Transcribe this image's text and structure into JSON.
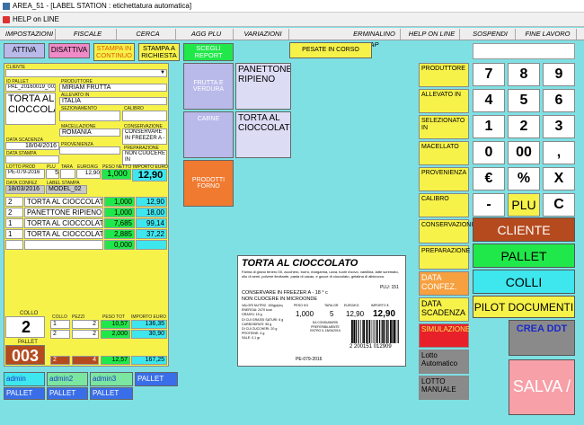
{
  "window": {
    "title": "AREA_51 - [LABEL STATION : etichettatura automatica]",
    "help": "HELP on LINE"
  },
  "menu": [
    "IMPOSTAZIONI",
    "FISCALE",
    "CERCA",
    "AGG PLU",
    "VARIAZIONI",
    "ERMINALINO AP",
    "HELP ON LINE",
    "SOSPENDI",
    "FINE LAVORO"
  ],
  "toolbar": {
    "attiva": "ATTIVA",
    "disattiva": "DISATTIVA",
    "stampa_continuo": "STAMPA IN CONTINUO",
    "stampa_richiesta": "STAMPA A RICHIESTA",
    "scegli_report": "SCEGLI REPORT",
    "pesate": "PESATE IN CORSO"
  },
  "form": {
    "cliente_lbl": "CLIENTE",
    "id_pallet_lbl": "ID PALLET",
    "id_pallet": "PAL_20160019_003",
    "produttore_lbl": "PRODUTTORE",
    "produttore": "MIRIAM FRUTTA",
    "allevato_lbl": "ALLEVATO IN",
    "allevato": "ITALIA",
    "product": "TORTA AL CIOCCOLATO",
    "sezionamento_lbl": "SEZIONAMENTO",
    "calibro_lbl": "CALIBRO",
    "macellazione_lbl": "MACELLAZIONE",
    "macellazione": "ROMANIA",
    "conservazione_lbl": "CONSERVAZIONE",
    "conservazione": "CONSERVARE IN FREEZER A -",
    "scadenza_lbl": "DATA SCADENZA",
    "scadenza": "18/04/2016",
    "provenienza_lbl": "PROVENIENZA",
    "preparazione_lbl": "PREPARAZIONE",
    "preparazione": "NON CUOCERE IN",
    "stampa_lbl": "DATA STAMPA",
    "lotto_lbl": "LOTTO PROD",
    "plu_lbl": "PLU",
    "tara_lbl": "TARA",
    "eurokg_lbl": "EURO/KG",
    "peso_lbl": "PESO NETTO",
    "importo_lbl": "IMPORTO EURO",
    "lotto": "PE-079-2016",
    "plu": "5",
    "tara": "",
    "eurokg": "12,90",
    "peso": "1,000",
    "importo": "12,90",
    "confez_lbl": "DATA CONFEZ",
    "label_lbl": "LABEL STAMPA",
    "confez": "18/03/2016",
    "label": "MODEL_02"
  },
  "weighings": [
    {
      "n": "2",
      "name": "TORTA AL CIOCCOLATO",
      "w": "1,000",
      "amt": "12,90"
    },
    {
      "n": "2",
      "name": "PANETTONE RIPIENO",
      "w": "1,000",
      "amt": "18,00"
    },
    {
      "n": "1",
      "name": "TORTA AL CIOCCOLATO",
      "w": "7,685",
      "amt": "99,14"
    },
    {
      "n": "1",
      "name": "TORTA AL CIOCCOLATO",
      "w": "2,885",
      "amt": "37,22"
    },
    {
      "n": "",
      "name": "",
      "w": "0,000",
      "amt": ""
    }
  ],
  "collo": {
    "label": "COLLO",
    "value": "2"
  },
  "pallet": {
    "label": "PALLET",
    "value": "003"
  },
  "totals": {
    "hdr": [
      "COLLO",
      "PEZZI",
      "PESO TOT",
      "IMPORTO EURO"
    ],
    "rows": [
      {
        "collo": "1",
        "pezzi": "2",
        "peso": "10,57",
        "imp": "136,35"
      },
      {
        "collo": "2",
        "pezzi": "2",
        "peso": "2,000",
        "imp": "30,90"
      }
    ],
    "sum": {
      "collo": "2",
      "pezzi": "4",
      "peso": "12,57",
      "imp": "167,25"
    }
  },
  "users": {
    "a1": "admin",
    "a2": "admin2",
    "a3": "admin3",
    "p": "PALLET"
  },
  "categories": [
    {
      "cat": "FRUTTA E VERDURA",
      "prod": "PANETTONE RIPIENO"
    },
    {
      "cat": "CARNE",
      "prod": "TORTA AL CIOCCOLATO"
    },
    {
      "cat": "PRODOTTI FORNO",
      "prod": ""
    }
  ],
  "label_preview": {
    "title": "TORTA AL CIOCCOLATO",
    "ingredients": "Farina di grano tenero 00, zucchero, burro, margarina, uova, tuorli d'uovo, vanillina, latte scremato, olio di semi, polvere lievitante, pasta di cacao, e gocce di cioccolato, gelatina di albicocca.",
    "plu": "PLU: 151",
    "cons1": "CONSERVARE IN FREEZER A - 18 ° c",
    "cons2": "NON CUOCERE IN MICROONDE",
    "nutri": "VALORI NUTRIZ. 100g(a)eq\nENERGIA: 2470 kcal\nGRASSI: 15 g\nDI CUI GRASSI SATURI: 6 g\nCARBOIDRATI: 55 g\nDI CUI ZUCCHERI: 20 g\nPROTEINE: 4 g\nSALE: 0,1 gr",
    "peso_lbl": "PESO KG",
    "tara_lbl": "TARA GR",
    "eurokg_lbl": "EURO/KG",
    "importo_lbl": "IMPORTO €",
    "peso": "1,000",
    "tara": "5",
    "eurokg": "12,90",
    "importo": "12,90",
    "lotto": "PE-079-2016",
    "date_note": "DA CONSUMARSI PREFERIBILMENTE ENTRO IL 18/04/2016",
    "barcode": "2 200151 012909"
  },
  "right_side": [
    "PRODUTTORE",
    "ALLEVATO IN",
    "SELEZIONATO IN",
    "MACELLATO",
    "PROVENIENZA",
    "CALIBRO",
    "CONSERVAZIONI",
    "PREPARAZIONE",
    "DATA CONFEZ.",
    "DATA SCADENZA",
    "SIMULAZIONE",
    "Lotto Automatico",
    "LOTTO MANUALE"
  ],
  "keypad": [
    "7",
    "8",
    "9",
    "4",
    "5",
    "6",
    "1",
    "2",
    "3",
    "0",
    "00",
    ",",
    "€",
    "%",
    "X",
    "-",
    "PLU",
    "C"
  ],
  "actions": {
    "cliente": "CLIENTE",
    "pallet": "PALLET",
    "colli": "COLLI",
    "pilot": "PILOT DOCUMENTI",
    "ddt": "CREA DDT",
    "salva": "SALVA /"
  },
  "colors": {
    "bg": "#7fe0e4",
    "yellow": "#f7f24a",
    "green": "#21e84a",
    "cyan": "#3ee6ee",
    "brown": "#b54a1e",
    "pink": "#f7a0a8"
  }
}
